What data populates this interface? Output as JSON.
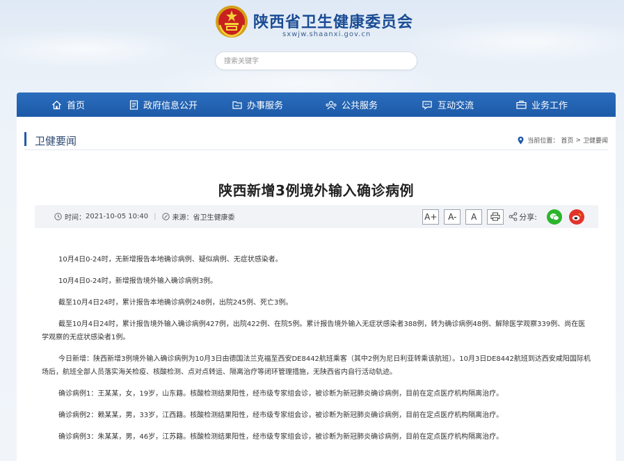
{
  "header": {
    "title": "陕西省卫生健康委员会",
    "url": "sxwjw.shaanxi.gov.cn",
    "search_placeholder": "搜索关键字"
  },
  "nav": {
    "items": [
      {
        "label": "首页",
        "icon": "home-icon"
      },
      {
        "label": "政府信息公开",
        "icon": "document-icon"
      },
      {
        "label": "办事服务",
        "icon": "folder-icon"
      },
      {
        "label": "公共服务",
        "icon": "public-service-icon"
      },
      {
        "label": "互动交流",
        "icon": "chat-icon"
      },
      {
        "label": "业务工作",
        "icon": "briefcase-icon"
      }
    ]
  },
  "breadcrumb": {
    "section_title": "卫健要闻",
    "prefix": "当前位置：",
    "home": "首页",
    "separator": ">",
    "current": "卫健要闻"
  },
  "article": {
    "title": "陕西新增3例境外输入确诊病例",
    "time_label": "时间：",
    "time": "2021-10-05 10:40",
    "source_label": "来源：",
    "source": "省卫生健康委",
    "font_buttons": [
      "A+",
      "A-",
      "A"
    ],
    "share_label": "分享:",
    "paragraphs": [
      "10月4日0-24时，无新增报告本地确诊病例、疑似病例、无症状感染者。",
      "10月4日0-24时，新增报告境外输入确诊病例3例。",
      "截至10月4日24时，累计报告本地确诊病例248例，出院245例、死亡3例。",
      "截至10月4日24时，累计报告境外输入确诊病例427例，出院422例、在院5例。累计报告境外输入无症状感染者388例，转为确诊病例48例、解除医学观察339例、尚在医学观察的无症状感染者1例。",
      "今日新增：陕西新增3例境外输入确诊病例为10月3日由德国法兰克福至西安DE8442航班乘客（其中2例为尼日利亚转乘该航班）。10月3日DE8442航班到达西安咸阳国际机场后，航班全部人员落实海关检疫、核酸检测、点对点转运、隔离治疗等闭环管理措施，无陕西省内自行活动轨迹。",
      "确诊病例1：王某某，女，19岁，山东籍。核酸检测结果阳性，经市级专家组会诊，被诊断为新冠肺炎确诊病例，目前在定点医疗机构隔离治疗。",
      "确诊病例2：赖某某，男，33岁，江西籍。核酸检测结果阳性，经市级专家组会诊，被诊断为新冠肺炎确诊病例，目前在定点医疗机构隔离治疗。",
      "确诊病例3：朱某某，男，46岁，江苏籍。核酸检测结果阳性，经市级专家组会诊，被诊断为新冠肺炎确诊病例，目前在定点医疗机构隔离治疗。"
    ]
  },
  "colors": {
    "nav_blue": "#1d5aa8",
    "brand_blue": "#1a4c94",
    "wechat_green": "#2cb52c",
    "weibo_red": "#e2332c"
  }
}
